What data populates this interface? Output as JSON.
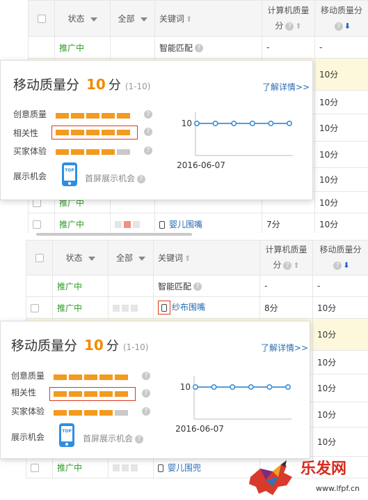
{
  "table_top": {
    "headers": {
      "status": "状态",
      "all": "全部",
      "keyword": "关键词",
      "pc_quality_line1": "计算机质量",
      "pc_quality_line2": "分",
      "mobile_quality": "移动质量分"
    },
    "rows": [
      {
        "status": "推广中",
        "keyword": "智能匹配",
        "pc": "-",
        "mobile": "-"
      },
      {
        "status": "",
        "keyword": "",
        "pc": "",
        "mobile": "10分"
      },
      {
        "status": "",
        "keyword": "",
        "pc": "",
        "mobile": "10分"
      },
      {
        "status": "",
        "keyword": "",
        "pc": "",
        "mobile": "10分"
      },
      {
        "status": "",
        "keyword": "",
        "pc": "",
        "mobile": "10分"
      },
      {
        "status": "",
        "keyword": "",
        "pc": "",
        "mobile": "10分"
      },
      {
        "status": "推广中",
        "keyword": "",
        "pc": "",
        "mobile": "10分"
      },
      {
        "status": "推广中",
        "keyword": "婴儿围嘴",
        "pc": "7分",
        "mobile": "10分"
      }
    ]
  },
  "popup_top": {
    "title": "移动质量分",
    "score": "10",
    "unit": "分",
    "range": "(1-10)",
    "more_link": "了解详情>>",
    "labels": {
      "creative": "创意质量",
      "relevance": "相关性",
      "experience": "买家体验",
      "display": "展示机会"
    },
    "display_value": "首屏展示机会",
    "phone_badge": "TOP",
    "chart": {
      "y_tick": "10",
      "x_tick": "2016-06-07"
    }
  },
  "table_bottom": {
    "headers": {
      "status": "状态",
      "all": "全部",
      "keyword": "关键词",
      "pc_quality_line1": "计算机质量",
      "pc_quality_line2": "分",
      "mobile_quality": "移动质量分"
    },
    "rows": [
      {
        "status": "推广中",
        "keyword": "智能匹配",
        "pc": "-",
        "mobile": "-"
      },
      {
        "status": "推广中",
        "keyword": "纱布围嘴",
        "pc": "8分",
        "mobile": "10分"
      },
      {
        "status": "",
        "keyword": "",
        "pc": "",
        "mobile": "10分"
      },
      {
        "status": "",
        "keyword": "",
        "pc": "",
        "mobile": "10分"
      },
      {
        "status": "",
        "keyword": "",
        "pc": "",
        "mobile": "10分"
      },
      {
        "status": "",
        "keyword": "",
        "pc": "",
        "mobile": "10分"
      },
      {
        "status": "",
        "keyword": "",
        "pc": "",
        "mobile": "10分"
      },
      {
        "status": "推广中",
        "keyword": "婴儿围兜",
        "pc": "",
        "mobile": ""
      }
    ]
  },
  "popup_bottom": {
    "title": "移动质量分",
    "score": "10",
    "unit": "分",
    "range": "(1-10)",
    "more_link": "了解详情>>",
    "labels": {
      "creative": "创意质量",
      "relevance": "相关性",
      "experience": "买家体验",
      "display": "展示机会"
    },
    "display_value": "首屏展示机会",
    "phone_badge": "TOP",
    "chart": {
      "y_tick": "10",
      "x_tick": "2016-06-07"
    }
  },
  "chart_data": [
    {
      "type": "line",
      "x_tick_labels": [
        "2016-06-07"
      ],
      "y_tick_labels": [
        "10"
      ],
      "series": [
        {
          "values": [
            10,
            10,
            10,
            10,
            10,
            10
          ]
        }
      ]
    },
    {
      "type": "line",
      "x_tick_labels": [
        "2016-06-07"
      ],
      "y_tick_labels": [
        "10"
      ],
      "series": [
        {
          "values": [
            10,
            10,
            10,
            10,
            10,
            10
          ]
        }
      ]
    }
  ],
  "watermark": {
    "brand": "乐发网",
    "url": "www.lfpf.cn"
  },
  "colors": {
    "accent_orange": "#f39a1f",
    "status_green": "#2f9a28",
    "link_blue": "#2a6cb3",
    "highlight_red": "#d9381e",
    "row_highlight": "#fdf8dc"
  }
}
